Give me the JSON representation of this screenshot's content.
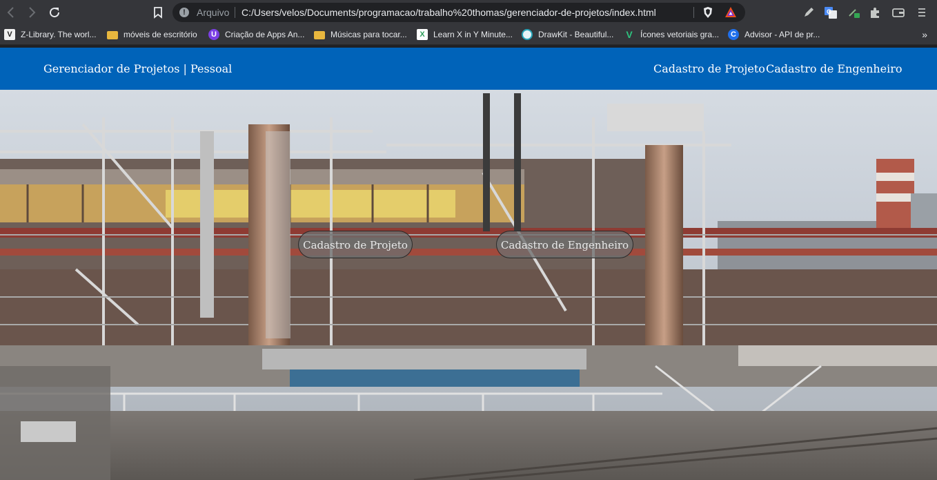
{
  "browser": {
    "scheme_label": "Arquivo",
    "url": "C:/Users/velos/Documents/programacao/trabalho%20thomas/gerenciador-de-projetos/index.html",
    "bookmarks": [
      {
        "label": "Z-Library. The worl...",
        "icon": "z-library-icon"
      },
      {
        "label": "móveis de escritório",
        "icon": "folder-icon"
      },
      {
        "label": "Criação de Apps An...",
        "icon": "app-icon"
      },
      {
        "label": "Músicas para tocar...",
        "icon": "folder-icon"
      },
      {
        "label": "Learn X in Y Minute...",
        "icon": "learnx-icon"
      },
      {
        "label": "DrawKit - Beautiful...",
        "icon": "drawkit-icon"
      },
      {
        "label": "Ícones vetoriais gra...",
        "icon": "vector-icon"
      },
      {
        "label": "Advisor - API de pr...",
        "icon": "advisor-icon"
      }
    ],
    "more_bookmarks": "»"
  },
  "navbar": {
    "brand": "Gerenciador de Projetos | Pessoal",
    "links": [
      "Cadastro de Projeto",
      "Cadastro de Engenheiro"
    ],
    "background": "#0063b9"
  },
  "hero": {
    "buttons": [
      "Cadastro de Projeto",
      "Cadastro de Engenheiro"
    ],
    "image_subject": "industrial-refinery-photo"
  }
}
